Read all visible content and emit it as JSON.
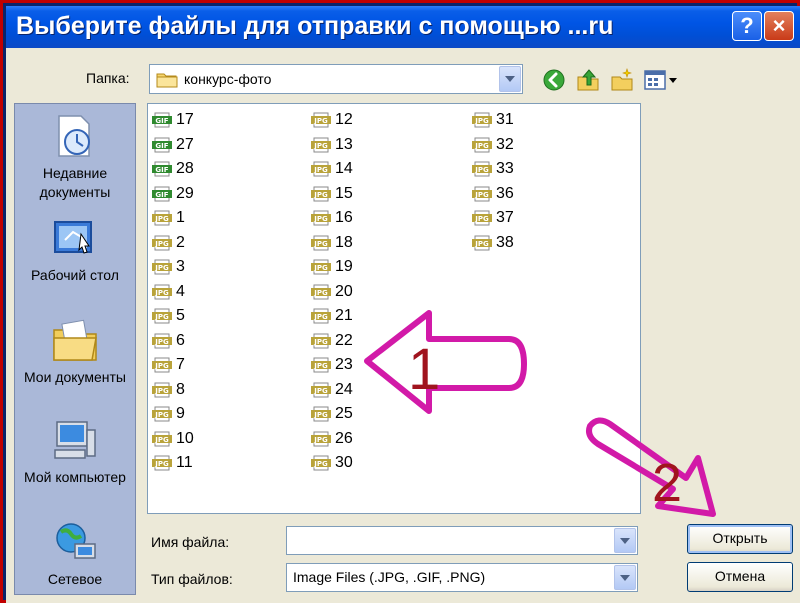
{
  "window": {
    "title": "Выберите файлы для отправки с помощью ...ru",
    "help_glyph": "?",
    "close_glyph": "×"
  },
  "toolbar": {
    "look_in_label": "Папка:",
    "look_in_value": "конкурс-фото",
    "icons": [
      "back-icon",
      "up-folder-icon",
      "new-folder-icon",
      "view-menu-icon"
    ]
  },
  "places": [
    {
      "label": "Недавние документы",
      "icon": "recent-documents-icon"
    },
    {
      "label": "Рабочий стол",
      "icon": "desktop-icon"
    },
    {
      "label": "Мои документы",
      "icon": "my-documents-icon"
    },
    {
      "label": "Мой компьютер",
      "icon": "my-computer-icon"
    },
    {
      "label": "Сетевое",
      "icon": "network-icon"
    }
  ],
  "files": {
    "columns": [
      [
        {
          "name": "17",
          "type": "GIF"
        },
        {
          "name": "27",
          "type": "GIF"
        },
        {
          "name": "28",
          "type": "GIF"
        },
        {
          "name": "29",
          "type": "GIF"
        },
        {
          "name": "1",
          "type": "JPG"
        },
        {
          "name": "2",
          "type": "JPG"
        },
        {
          "name": "3",
          "type": "JPG"
        },
        {
          "name": "4",
          "type": "JPG"
        },
        {
          "name": "5",
          "type": "JPG"
        },
        {
          "name": "6",
          "type": "JPG"
        },
        {
          "name": "7",
          "type": "JPG"
        },
        {
          "name": "8",
          "type": "JPG"
        },
        {
          "name": "9",
          "type": "JPG"
        },
        {
          "name": "10",
          "type": "JPG"
        },
        {
          "name": "11",
          "type": "JPG"
        }
      ],
      [
        {
          "name": "12",
          "type": "JPG"
        },
        {
          "name": "13",
          "type": "JPG"
        },
        {
          "name": "14",
          "type": "JPG"
        },
        {
          "name": "15",
          "type": "JPG"
        },
        {
          "name": "16",
          "type": "JPG"
        },
        {
          "name": "18",
          "type": "JPG"
        },
        {
          "name": "19",
          "type": "JPG"
        },
        {
          "name": "20",
          "type": "JPG"
        },
        {
          "name": "21",
          "type": "JPG"
        },
        {
          "name": "22",
          "type": "JPG"
        },
        {
          "name": "23",
          "type": "JPG"
        },
        {
          "name": "24",
          "type": "JPG"
        },
        {
          "name": "25",
          "type": "JPG"
        },
        {
          "name": "26",
          "type": "JPG"
        },
        {
          "name": "30",
          "type": "JPG"
        }
      ],
      [
        {
          "name": "31",
          "type": "JPG"
        },
        {
          "name": "32",
          "type": "JPG"
        },
        {
          "name": "33",
          "type": "JPG"
        },
        {
          "name": "36",
          "type": "JPG"
        },
        {
          "name": "37",
          "type": "JPG"
        },
        {
          "name": "38",
          "type": "JPG"
        }
      ]
    ]
  },
  "form": {
    "filename_label": "Имя файла:",
    "filename_value": "",
    "filetype_label": "Тип файлов:",
    "filetype_value": "Image Files (.JPG, .GIF, .PNG)",
    "open_label": "Открыть",
    "cancel_label": "Отмена"
  },
  "annotations": {
    "arrow1_label": "1",
    "arrow2_label": "2",
    "arrow_color": "#d21aa8",
    "number_color": "#a0141e"
  }
}
